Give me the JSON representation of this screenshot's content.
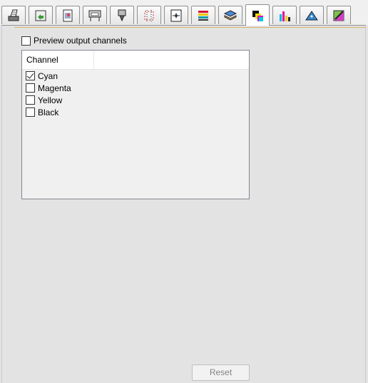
{
  "tabs": [
    {
      "icon": "printer-setup-icon"
    },
    {
      "icon": "media-arrow-icon"
    },
    {
      "icon": "image-file-icon"
    },
    {
      "icon": "printer-roll-icon"
    },
    {
      "icon": "print-head-icon"
    },
    {
      "icon": "crop-marks-icon"
    },
    {
      "icon": "page-layout-icon"
    },
    {
      "icon": "color-bars-icon"
    },
    {
      "icon": "layers-icon"
    },
    {
      "icon": "output-channels-icon",
      "active": true
    },
    {
      "icon": "ink-bars-icon"
    },
    {
      "icon": "tag-shape-icon"
    },
    {
      "icon": "color-picker-icon"
    }
  ],
  "preview": {
    "label": "Preview output channels",
    "checked": false
  },
  "channel_list": {
    "header": "Channel",
    "items": [
      {
        "label": "Cyan",
        "checked": true
      },
      {
        "label": "Magenta",
        "checked": false
      },
      {
        "label": "Yellow",
        "checked": false
      },
      {
        "label": "Black",
        "checked": false
      }
    ]
  },
  "reset_label": "Reset",
  "colors": {
    "accent_line": "#d6b46a",
    "panel_bg": "#e3e3e3",
    "disabled_text": "#838383"
  }
}
